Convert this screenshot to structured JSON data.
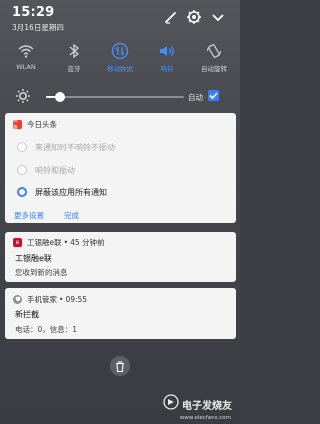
{
  "status": {
    "time": "15:29",
    "date": "3月16日星期四"
  },
  "header_icons": [
    "edit-icon",
    "gear-icon",
    "expand-icon"
  ],
  "tiles": [
    {
      "label": "WLAN",
      "icon": "wifi-icon",
      "on": false
    },
    {
      "label": "蓝牙",
      "icon": "bluetooth-icon",
      "on": false
    },
    {
      "label": "移动数据",
      "icon": "mobile-data-icon",
      "on": true
    },
    {
      "label": "响铃",
      "icon": "ring-icon",
      "on": true
    },
    {
      "label": "自动旋转",
      "icon": "rotate-icon",
      "on": false
    }
  ],
  "brightness": {
    "level": 0.1,
    "auto_label": "自动",
    "auto_checked": true
  },
  "toutiao": {
    "app_name": "今日头条",
    "badge_text": "头条",
    "options": [
      "来通知时不响铃不振动",
      "响铃和振动",
      "屏蔽该应用所有通知"
    ],
    "selected_index": 2,
    "more_settings": "更多设置",
    "done": "完成"
  },
  "gongyin": {
    "app_name": "工银融e联",
    "time_ago": "45 分钟前",
    "title": "工银融e联",
    "body": "您收到新的消息"
  },
  "guardian": {
    "app_name": "手机管家",
    "time": "09:55",
    "title": "新拦截",
    "body": "电话：0，信息：1"
  },
  "colors": {
    "accent": "#3e7ff0",
    "badge_red": "#e8412e",
    "guardian_gray": "#8d8d8d"
  },
  "watermark": {
    "text": "电子发烧友",
    "url": "www.elecfans.com"
  }
}
